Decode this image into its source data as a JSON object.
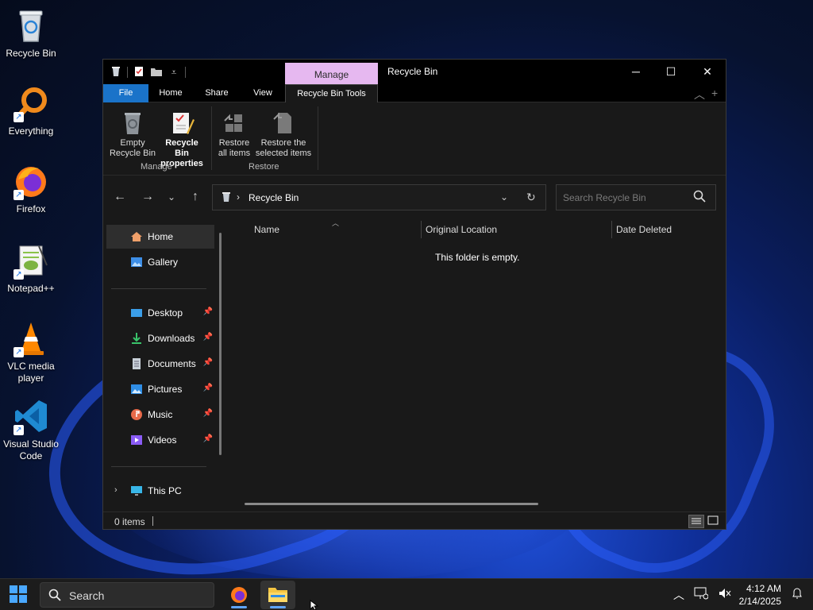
{
  "desktop": {
    "icons": [
      {
        "label": "Recycle Bin"
      },
      {
        "label": "Everything"
      },
      {
        "label": "Firefox"
      },
      {
        "label": "Notepad++"
      },
      {
        "label": "VLC media player"
      },
      {
        "label": "Visual Studio Code"
      }
    ]
  },
  "window": {
    "title": "Recycle Bin",
    "context_tab": "Manage",
    "tabs": {
      "file": "File",
      "home": "Home",
      "share": "Share",
      "view": "View",
      "tools": "Recycle Bin Tools"
    },
    "ribbon": {
      "empty_line1": "Empty",
      "empty_line2": "Recycle Bin",
      "props_line1": "Recycle Bin",
      "props_line2": "properties",
      "restore_all_line1": "Restore",
      "restore_all_line2": "all items",
      "restore_sel_line1": "Restore the",
      "restore_sel_line2": "selected items",
      "group_manage": "Manage",
      "group_restore": "Restore"
    },
    "address": {
      "crumb": "Recycle Bin"
    },
    "search": {
      "placeholder": "Search Recycle Bin"
    },
    "nav": {
      "home": "Home",
      "gallery": "Gallery",
      "desktop": "Desktop",
      "downloads": "Downloads",
      "documents": "Documents",
      "pictures": "Pictures",
      "music": "Music",
      "videos": "Videos",
      "this_pc": "This PC"
    },
    "columns": {
      "name": "Name",
      "original_location": "Original Location",
      "date_deleted": "Date Deleted"
    },
    "empty_message": "This folder is empty.",
    "status": {
      "items": "0 items"
    }
  },
  "taskbar": {
    "search_label": "Search",
    "time": "4:12 AM",
    "date": "2/14/2025"
  },
  "colors": {
    "file_tab": "#1a73c9",
    "manage_context": "#e6b8f0",
    "window_bg": "#191919"
  }
}
